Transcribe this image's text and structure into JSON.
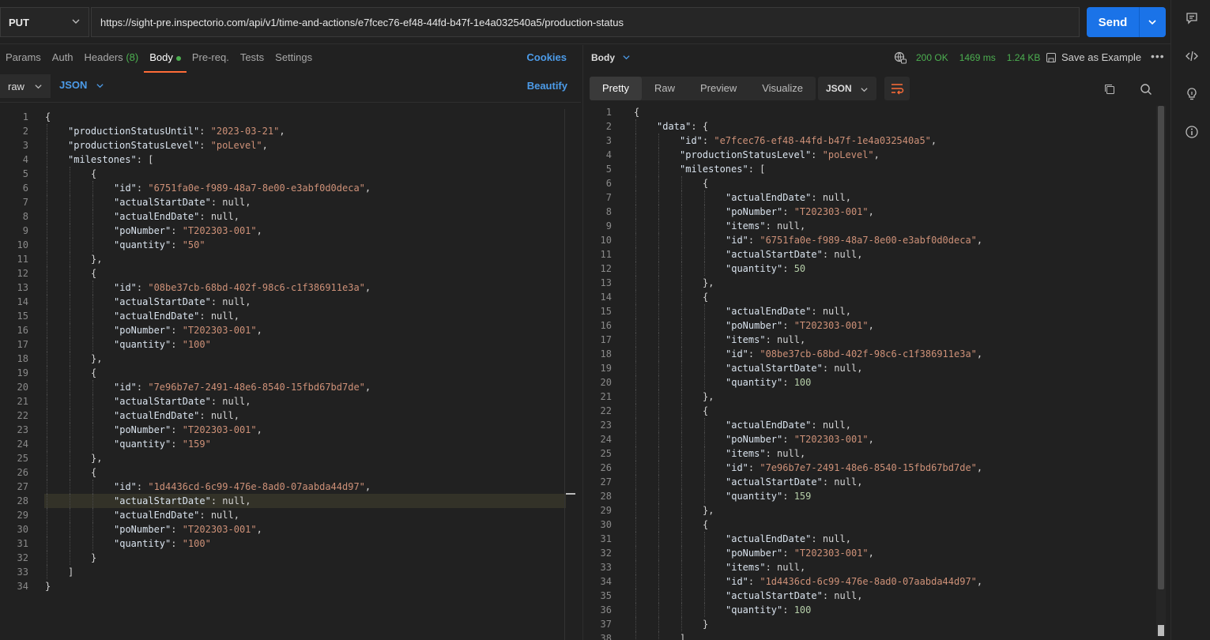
{
  "request": {
    "method": "PUT",
    "url": "https://sight-pre.inspectorio.com/api/v1/time-and-actions/e7fcec76-ef48-44fd-b47f-1e4a032540a5/production-status",
    "send_label": "Send"
  },
  "request_tabs": {
    "params": "Params",
    "auth": "Auth",
    "headers": "Headers",
    "headers_count": "(8)",
    "body": "Body",
    "prereq": "Pre-req.",
    "tests": "Tests",
    "settings": "Settings",
    "cookies": "Cookies"
  },
  "body_options": {
    "mode": "raw",
    "format": "JSON",
    "beautify": "Beautify"
  },
  "request_body_lines": [
    {
      "n": "1",
      "indent": 0,
      "t": "{"
    },
    {
      "n": "2",
      "indent": 1,
      "k": "productionStatusUntil",
      "v": "\"2023-03-21\"",
      "vt": "s",
      "c": ","
    },
    {
      "n": "3",
      "indent": 1,
      "k": "productionStatusLevel",
      "v": "\"poLevel\"",
      "vt": "s",
      "c": ","
    },
    {
      "n": "4",
      "indent": 1,
      "k": "milestones",
      "v": "[",
      "vt": "n",
      "c": ""
    },
    {
      "n": "5",
      "indent": 2,
      "t": "{"
    },
    {
      "n": "6",
      "indent": 3,
      "k": "id",
      "v": "\"6751fa0e-f989-48a7-8e00-e3abf0d0deca\"",
      "vt": "s",
      "c": ","
    },
    {
      "n": "7",
      "indent": 3,
      "k": "actualStartDate",
      "v": "null",
      "vt": "n",
      "c": ","
    },
    {
      "n": "8",
      "indent": 3,
      "k": "actualEndDate",
      "v": "null",
      "vt": "n",
      "c": ","
    },
    {
      "n": "9",
      "indent": 3,
      "k": "poNumber",
      "v": "\"T202303-001\"",
      "vt": "s",
      "c": ","
    },
    {
      "n": "10",
      "indent": 3,
      "k": "quantity",
      "v": "\"50\"",
      "vt": "s",
      "c": ""
    },
    {
      "n": "11",
      "indent": 2,
      "t": "},"
    },
    {
      "n": "12",
      "indent": 2,
      "t": "{"
    },
    {
      "n": "13",
      "indent": 3,
      "k": "id",
      "v": "\"08be37cb-68bd-402f-98c6-c1f386911e3a\"",
      "vt": "s",
      "c": ","
    },
    {
      "n": "14",
      "indent": 3,
      "k": "actualStartDate",
      "v": "null",
      "vt": "n",
      "c": ","
    },
    {
      "n": "15",
      "indent": 3,
      "k": "actualEndDate",
      "v": "null",
      "vt": "n",
      "c": ","
    },
    {
      "n": "16",
      "indent": 3,
      "k": "poNumber",
      "v": "\"T202303-001\"",
      "vt": "s",
      "c": ","
    },
    {
      "n": "17",
      "indent": 3,
      "k": "quantity",
      "v": "\"100\"",
      "vt": "s",
      "c": ""
    },
    {
      "n": "18",
      "indent": 2,
      "t": "},"
    },
    {
      "n": "19",
      "indent": 2,
      "t": "{"
    },
    {
      "n": "20",
      "indent": 3,
      "k": "id",
      "v": "\"7e96b7e7-2491-48e6-8540-15fbd67bd7de\"",
      "vt": "s",
      "c": ","
    },
    {
      "n": "21",
      "indent": 3,
      "k": "actualStartDate",
      "v": "null",
      "vt": "n",
      "c": ","
    },
    {
      "n": "22",
      "indent": 3,
      "k": "actualEndDate",
      "v": "null",
      "vt": "n",
      "c": ","
    },
    {
      "n": "23",
      "indent": 3,
      "k": "poNumber",
      "v": "\"T202303-001\"",
      "vt": "s",
      "c": ","
    },
    {
      "n": "24",
      "indent": 3,
      "k": "quantity",
      "v": "\"159\"",
      "vt": "s",
      "c": ""
    },
    {
      "n": "25",
      "indent": 2,
      "t": "},"
    },
    {
      "n": "26",
      "indent": 2,
      "t": "{"
    },
    {
      "n": "27",
      "indent": 3,
      "k": "id",
      "v": "\"1d4436cd-6c99-476e-8ad0-07aabda44d97\"",
      "vt": "s",
      "c": ","
    },
    {
      "n": "28",
      "indent": 3,
      "k": "actualStartDate",
      "v": "null",
      "vt": "n",
      "c": ","
    },
    {
      "n": "29",
      "indent": 3,
      "k": "actualEndDate",
      "v": "null",
      "vt": "n",
      "c": ","
    },
    {
      "n": "30",
      "indent": 3,
      "k": "poNumber",
      "v": "\"T202303-001\"",
      "vt": "s",
      "c": ","
    },
    {
      "n": "31",
      "indent": 3,
      "k": "quantity",
      "v": "\"100\"",
      "vt": "s",
      "c": ""
    },
    {
      "n": "32",
      "indent": 2,
      "t": "}"
    },
    {
      "n": "33",
      "indent": 1,
      "t": "]"
    },
    {
      "n": "34",
      "indent": 0,
      "t": "}"
    }
  ],
  "response": {
    "body_label": "Body",
    "status": "200 OK",
    "time": "1469 ms",
    "size": "1.24 KB",
    "save_example": "Save as Example",
    "views": [
      "Pretty",
      "Raw",
      "Preview",
      "Visualize"
    ],
    "format": "JSON"
  },
  "response_body_lines": [
    {
      "n": "1",
      "indent": 0,
      "t": "{"
    },
    {
      "n": "2",
      "indent": 1,
      "k": "data",
      "v": "{",
      "vt": "n",
      "c": ""
    },
    {
      "n": "3",
      "indent": 2,
      "k": "id",
      "v": "\"e7fcec76-ef48-44fd-b47f-1e4a032540a5\"",
      "vt": "s",
      "c": ","
    },
    {
      "n": "4",
      "indent": 2,
      "k": "productionStatusLevel",
      "v": "\"poLevel\"",
      "vt": "s",
      "c": ","
    },
    {
      "n": "5",
      "indent": 2,
      "k": "milestones",
      "v": "[",
      "vt": "n",
      "c": ""
    },
    {
      "n": "6",
      "indent": 3,
      "t": "{"
    },
    {
      "n": "7",
      "indent": 4,
      "k": "actualEndDate",
      "v": "null",
      "vt": "n",
      "c": ","
    },
    {
      "n": "8",
      "indent": 4,
      "k": "poNumber",
      "v": "\"T202303-001\"",
      "vt": "s",
      "c": ","
    },
    {
      "n": "9",
      "indent": 4,
      "k": "items",
      "v": "null",
      "vt": "n",
      "c": ","
    },
    {
      "n": "10",
      "indent": 4,
      "k": "id",
      "v": "\"6751fa0e-f989-48a7-8e00-e3abf0d0deca\"",
      "vt": "s",
      "c": ","
    },
    {
      "n": "11",
      "indent": 4,
      "k": "actualStartDate",
      "v": "null",
      "vt": "n",
      "c": ","
    },
    {
      "n": "12",
      "indent": 4,
      "k": "quantity",
      "v": "50",
      "vt": "num",
      "c": ""
    },
    {
      "n": "13",
      "indent": 3,
      "t": "},"
    },
    {
      "n": "14",
      "indent": 3,
      "t": "{"
    },
    {
      "n": "15",
      "indent": 4,
      "k": "actualEndDate",
      "v": "null",
      "vt": "n",
      "c": ","
    },
    {
      "n": "16",
      "indent": 4,
      "k": "poNumber",
      "v": "\"T202303-001\"",
      "vt": "s",
      "c": ","
    },
    {
      "n": "17",
      "indent": 4,
      "k": "items",
      "v": "null",
      "vt": "n",
      "c": ","
    },
    {
      "n": "18",
      "indent": 4,
      "k": "id",
      "v": "\"08be37cb-68bd-402f-98c6-c1f386911e3a\"",
      "vt": "s",
      "c": ","
    },
    {
      "n": "19",
      "indent": 4,
      "k": "actualStartDate",
      "v": "null",
      "vt": "n",
      "c": ","
    },
    {
      "n": "20",
      "indent": 4,
      "k": "quantity",
      "v": "100",
      "vt": "num",
      "c": ""
    },
    {
      "n": "21",
      "indent": 3,
      "t": "},"
    },
    {
      "n": "22",
      "indent": 3,
      "t": "{"
    },
    {
      "n": "23",
      "indent": 4,
      "k": "actualEndDate",
      "v": "null",
      "vt": "n",
      "c": ","
    },
    {
      "n": "24",
      "indent": 4,
      "k": "poNumber",
      "v": "\"T202303-001\"",
      "vt": "s",
      "c": ","
    },
    {
      "n": "25",
      "indent": 4,
      "k": "items",
      "v": "null",
      "vt": "n",
      "c": ","
    },
    {
      "n": "26",
      "indent": 4,
      "k": "id",
      "v": "\"7e96b7e7-2491-48e6-8540-15fbd67bd7de\"",
      "vt": "s",
      "c": ","
    },
    {
      "n": "27",
      "indent": 4,
      "k": "actualStartDate",
      "v": "null",
      "vt": "n",
      "c": ","
    },
    {
      "n": "28",
      "indent": 4,
      "k": "quantity",
      "v": "159",
      "vt": "num",
      "c": ""
    },
    {
      "n": "29",
      "indent": 3,
      "t": "},"
    },
    {
      "n": "30",
      "indent": 3,
      "t": "{"
    },
    {
      "n": "31",
      "indent": 4,
      "k": "actualEndDate",
      "v": "null",
      "vt": "n",
      "c": ","
    },
    {
      "n": "32",
      "indent": 4,
      "k": "poNumber",
      "v": "\"T202303-001\"",
      "vt": "s",
      "c": ","
    },
    {
      "n": "33",
      "indent": 4,
      "k": "items",
      "v": "null",
      "vt": "n",
      "c": ","
    },
    {
      "n": "34",
      "indent": 4,
      "k": "id",
      "v": "\"1d4436cd-6c99-476e-8ad0-07aabda44d97\"",
      "vt": "s",
      "c": ","
    },
    {
      "n": "35",
      "indent": 4,
      "k": "actualStartDate",
      "v": "null",
      "vt": "n",
      "c": ","
    },
    {
      "n": "36",
      "indent": 4,
      "k": "quantity",
      "v": "100",
      "vt": "num",
      "c": ""
    },
    {
      "n": "37",
      "indent": 3,
      "t": "}"
    },
    {
      "n": "38",
      "indent": 2,
      "t": "]"
    }
  ],
  "sidebar_icons": [
    "comment-icon",
    "code-icon",
    "lightbulb-icon",
    "info-icon"
  ],
  "colors": {
    "accent": "#1a73e8",
    "tab_underline": "#ff6c37",
    "status_ok": "#4caf50",
    "link": "#4c9be8"
  }
}
